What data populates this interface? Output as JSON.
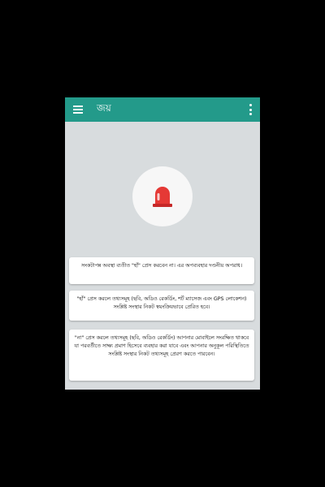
{
  "app": {
    "title": "জয়"
  },
  "icons": {
    "menu": "hamburger-menu-icon",
    "more": "more-vert-icon",
    "siren": "red-siren-alarm-icon"
  },
  "colors": {
    "appbar": "#239a8a",
    "background": "#d8dcde",
    "siren": "#e53935"
  },
  "cards": [
    {
      "text": "সংকটাপন্ন অবস্থা ব্যতীত \"হাঁ\" প্রেস করবেন না। এর অপব্যবহার দণ্ডনীয় অপরাধ।"
    },
    {
      "text": "\"হাঁ\" প্রেস করলে তথ্যসমূহ (ছবি, অডিও রেকর্ডিং, শর্ট ম্যাসেজ এবং GPS লোকেশন) সংশ্লিষ্ট সংস্থার নিকট স্বয়ংক্রিয়ভাবে প্রেরিত হবে।"
    },
    {
      "text": "\"না\" প্রেস করলে তথ্যসমূহ (ছবি, অডিও রেকর্ডিং) আপনার মোবাইলে সংরক্ষিত থাকবে যা পরবর্তীতে সাক্ষ্য প্রমাণ হিসেবে ব্যবহার করা যাবে এবং আপনার অনুকূল পরিস্থিতিতে সংশ্লিষ্ট সংস্থার নিকট তথ্যসমূহ প্রেরণ করতে পারবেন।"
    }
  ]
}
